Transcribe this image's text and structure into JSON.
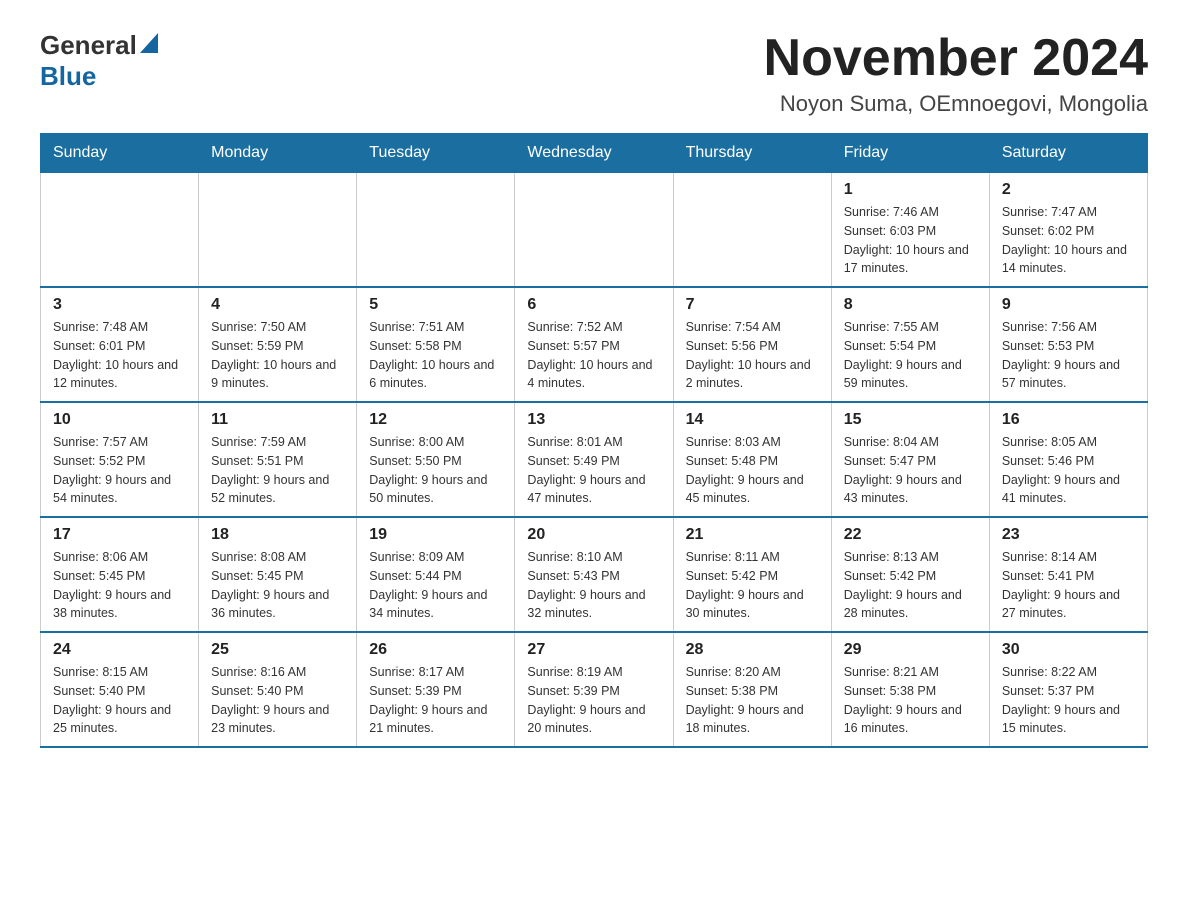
{
  "header": {
    "logo_general": "General",
    "logo_blue": "Blue",
    "month_title": "November 2024",
    "location": "Noyon Suma, OEmnoegovi, Mongolia"
  },
  "weekdays": [
    "Sunday",
    "Monday",
    "Tuesday",
    "Wednesday",
    "Thursday",
    "Friday",
    "Saturday"
  ],
  "weeks": [
    [
      {
        "day": "",
        "sunrise": "",
        "sunset": "",
        "daylight": ""
      },
      {
        "day": "",
        "sunrise": "",
        "sunset": "",
        "daylight": ""
      },
      {
        "day": "",
        "sunrise": "",
        "sunset": "",
        "daylight": ""
      },
      {
        "day": "",
        "sunrise": "",
        "sunset": "",
        "daylight": ""
      },
      {
        "day": "",
        "sunrise": "",
        "sunset": "",
        "daylight": ""
      },
      {
        "day": "1",
        "sunrise": "Sunrise: 7:46 AM",
        "sunset": "Sunset: 6:03 PM",
        "daylight": "Daylight: 10 hours and 17 minutes."
      },
      {
        "day": "2",
        "sunrise": "Sunrise: 7:47 AM",
        "sunset": "Sunset: 6:02 PM",
        "daylight": "Daylight: 10 hours and 14 minutes."
      }
    ],
    [
      {
        "day": "3",
        "sunrise": "Sunrise: 7:48 AM",
        "sunset": "Sunset: 6:01 PM",
        "daylight": "Daylight: 10 hours and 12 minutes."
      },
      {
        "day": "4",
        "sunrise": "Sunrise: 7:50 AM",
        "sunset": "Sunset: 5:59 PM",
        "daylight": "Daylight: 10 hours and 9 minutes."
      },
      {
        "day": "5",
        "sunrise": "Sunrise: 7:51 AM",
        "sunset": "Sunset: 5:58 PM",
        "daylight": "Daylight: 10 hours and 6 minutes."
      },
      {
        "day": "6",
        "sunrise": "Sunrise: 7:52 AM",
        "sunset": "Sunset: 5:57 PM",
        "daylight": "Daylight: 10 hours and 4 minutes."
      },
      {
        "day": "7",
        "sunrise": "Sunrise: 7:54 AM",
        "sunset": "Sunset: 5:56 PM",
        "daylight": "Daylight: 10 hours and 2 minutes."
      },
      {
        "day": "8",
        "sunrise": "Sunrise: 7:55 AM",
        "sunset": "Sunset: 5:54 PM",
        "daylight": "Daylight: 9 hours and 59 minutes."
      },
      {
        "day": "9",
        "sunrise": "Sunrise: 7:56 AM",
        "sunset": "Sunset: 5:53 PM",
        "daylight": "Daylight: 9 hours and 57 minutes."
      }
    ],
    [
      {
        "day": "10",
        "sunrise": "Sunrise: 7:57 AM",
        "sunset": "Sunset: 5:52 PM",
        "daylight": "Daylight: 9 hours and 54 minutes."
      },
      {
        "day": "11",
        "sunrise": "Sunrise: 7:59 AM",
        "sunset": "Sunset: 5:51 PM",
        "daylight": "Daylight: 9 hours and 52 minutes."
      },
      {
        "day": "12",
        "sunrise": "Sunrise: 8:00 AM",
        "sunset": "Sunset: 5:50 PM",
        "daylight": "Daylight: 9 hours and 50 minutes."
      },
      {
        "day": "13",
        "sunrise": "Sunrise: 8:01 AM",
        "sunset": "Sunset: 5:49 PM",
        "daylight": "Daylight: 9 hours and 47 minutes."
      },
      {
        "day": "14",
        "sunrise": "Sunrise: 8:03 AM",
        "sunset": "Sunset: 5:48 PM",
        "daylight": "Daylight: 9 hours and 45 minutes."
      },
      {
        "day": "15",
        "sunrise": "Sunrise: 8:04 AM",
        "sunset": "Sunset: 5:47 PM",
        "daylight": "Daylight: 9 hours and 43 minutes."
      },
      {
        "day": "16",
        "sunrise": "Sunrise: 8:05 AM",
        "sunset": "Sunset: 5:46 PM",
        "daylight": "Daylight: 9 hours and 41 minutes."
      }
    ],
    [
      {
        "day": "17",
        "sunrise": "Sunrise: 8:06 AM",
        "sunset": "Sunset: 5:45 PM",
        "daylight": "Daylight: 9 hours and 38 minutes."
      },
      {
        "day": "18",
        "sunrise": "Sunrise: 8:08 AM",
        "sunset": "Sunset: 5:45 PM",
        "daylight": "Daylight: 9 hours and 36 minutes."
      },
      {
        "day": "19",
        "sunrise": "Sunrise: 8:09 AM",
        "sunset": "Sunset: 5:44 PM",
        "daylight": "Daylight: 9 hours and 34 minutes."
      },
      {
        "day": "20",
        "sunrise": "Sunrise: 8:10 AM",
        "sunset": "Sunset: 5:43 PM",
        "daylight": "Daylight: 9 hours and 32 minutes."
      },
      {
        "day": "21",
        "sunrise": "Sunrise: 8:11 AM",
        "sunset": "Sunset: 5:42 PM",
        "daylight": "Daylight: 9 hours and 30 minutes."
      },
      {
        "day": "22",
        "sunrise": "Sunrise: 8:13 AM",
        "sunset": "Sunset: 5:42 PM",
        "daylight": "Daylight: 9 hours and 28 minutes."
      },
      {
        "day": "23",
        "sunrise": "Sunrise: 8:14 AM",
        "sunset": "Sunset: 5:41 PM",
        "daylight": "Daylight: 9 hours and 27 minutes."
      }
    ],
    [
      {
        "day": "24",
        "sunrise": "Sunrise: 8:15 AM",
        "sunset": "Sunset: 5:40 PM",
        "daylight": "Daylight: 9 hours and 25 minutes."
      },
      {
        "day": "25",
        "sunrise": "Sunrise: 8:16 AM",
        "sunset": "Sunset: 5:40 PM",
        "daylight": "Daylight: 9 hours and 23 minutes."
      },
      {
        "day": "26",
        "sunrise": "Sunrise: 8:17 AM",
        "sunset": "Sunset: 5:39 PM",
        "daylight": "Daylight: 9 hours and 21 minutes."
      },
      {
        "day": "27",
        "sunrise": "Sunrise: 8:19 AM",
        "sunset": "Sunset: 5:39 PM",
        "daylight": "Daylight: 9 hours and 20 minutes."
      },
      {
        "day": "28",
        "sunrise": "Sunrise: 8:20 AM",
        "sunset": "Sunset: 5:38 PM",
        "daylight": "Daylight: 9 hours and 18 minutes."
      },
      {
        "day": "29",
        "sunrise": "Sunrise: 8:21 AM",
        "sunset": "Sunset: 5:38 PM",
        "daylight": "Daylight: 9 hours and 16 minutes."
      },
      {
        "day": "30",
        "sunrise": "Sunrise: 8:22 AM",
        "sunset": "Sunset: 5:37 PM",
        "daylight": "Daylight: 9 hours and 15 minutes."
      }
    ]
  ]
}
